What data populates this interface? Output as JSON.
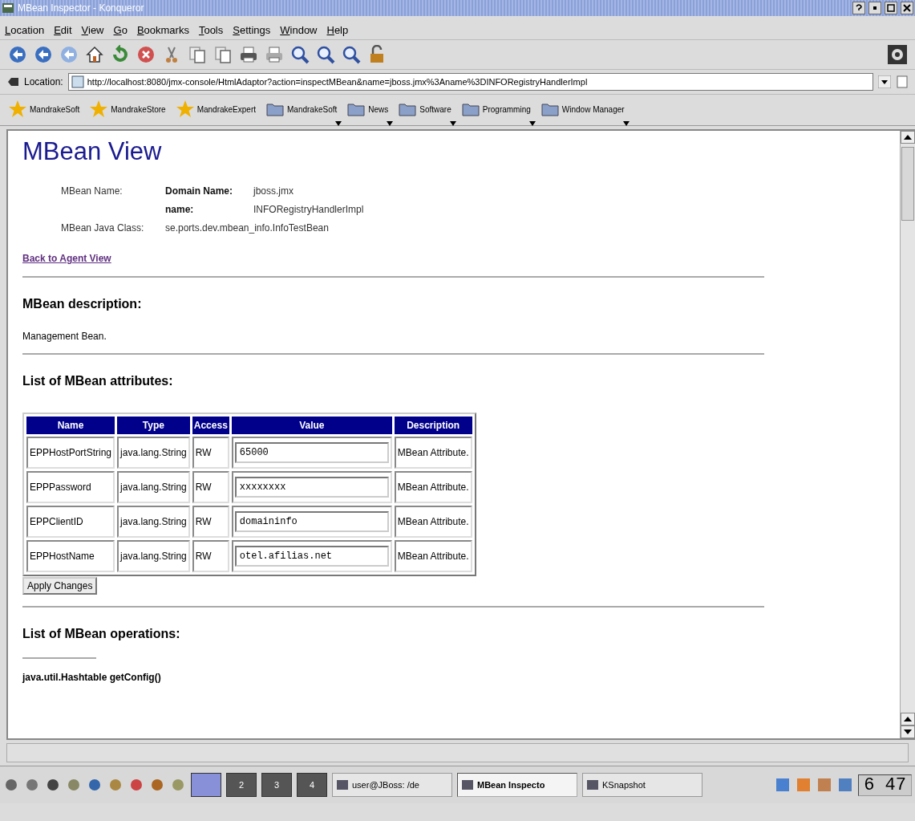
{
  "window": {
    "title": "MBean Inspector - Konqueror"
  },
  "menu": [
    "Location",
    "Edit",
    "View",
    "Go",
    "Bookmarks",
    "Tools",
    "Settings",
    "Window",
    "Help"
  ],
  "location": {
    "label": "Location:",
    "url": "http://localhost:8080/jmx-console/HtmlAdaptor?action=inspectMBean&name=jboss.jmx%3Aname%3DINFORegistryHandlerImpl"
  },
  "bookmarks": [
    {
      "label": "MandrakeSoft",
      "kind": "star"
    },
    {
      "label": "MandrakeStore",
      "kind": "star"
    },
    {
      "label": "MandrakeExpert",
      "kind": "star"
    },
    {
      "label": "MandrakeSoft",
      "kind": "folder"
    },
    {
      "label": "News",
      "kind": "folder"
    },
    {
      "label": "Software",
      "kind": "folder"
    },
    {
      "label": "Programming",
      "kind": "folder"
    },
    {
      "label": "Window Manager",
      "kind": "folder"
    }
  ],
  "page": {
    "title": "MBean View",
    "mbean_name_label": "MBean Name:",
    "domain_name_label": "Domain Name:",
    "domain_name": "jboss.jmx",
    "name_label": "name:",
    "name": "INFORegistryHandlerImpl",
    "java_class_label": "MBean Java Class:",
    "java_class": "se.ports.dev.mbean_info.InfoTestBean",
    "back_link": "Back to Agent View",
    "description_heading": "MBean description:",
    "description": "Management Bean.",
    "attributes_heading": "List of MBean attributes:",
    "table": {
      "columns": [
        "Name",
        "Type",
        "Access",
        "Value",
        "Description"
      ],
      "rows": [
        {
          "name": "EPPHostPortString",
          "type": "java.lang.String",
          "access": "RW",
          "value": "65000",
          "description": "MBean Attribute."
        },
        {
          "name": "EPPPassword",
          "type": "java.lang.String",
          "access": "RW",
          "value": "xxxxxxxx",
          "description": "MBean Attribute."
        },
        {
          "name": "EPPClientID",
          "type": "java.lang.String",
          "access": "RW",
          "value": "domaininfo",
          "description": "MBean Attribute."
        },
        {
          "name": "EPPHostName",
          "type": "java.lang.String",
          "access": "RW",
          "value": "otel.afilias.net",
          "description": "MBean Attribute."
        }
      ]
    },
    "apply_button": "Apply Changes",
    "operations_heading": "List of MBean operations:",
    "operation": "java.util.Hashtable getConfig()"
  },
  "taskbar": {
    "pager": [
      {
        "selected": true
      },
      {
        "label": "2",
        "selected": false
      },
      {
        "label": "3",
        "selected": false
      },
      {
        "label": "4",
        "selected": false
      }
    ],
    "tasks": [
      {
        "label": "user@JBoss: /de",
        "selected": false
      },
      {
        "label": "MBean Inspecto",
        "selected": true
      },
      {
        "label": "KSnapshot",
        "selected": false
      }
    ],
    "clock": "6 47"
  }
}
